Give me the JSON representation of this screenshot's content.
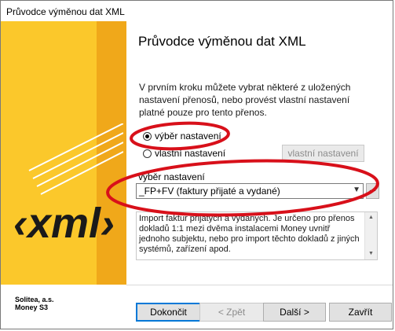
{
  "window": {
    "title": "Průvodce výměnou dat XML"
  },
  "wizard": {
    "heading": "Průvodce výměnou dat XML",
    "intro": "V prvním kroku můžete vybrat některé z uložených nastavení přenosů, nebo provést vlastní nastavení platné pouze pro tento přenos.",
    "options": [
      {
        "label": "výběr nastavení",
        "checked": true
      },
      {
        "label": "vlastní nastavení",
        "checked": false
      }
    ],
    "custom_settings_button": "vlastní nastavení",
    "select_label": "výběr nastavení",
    "select_value": "_FP+FV (faktury přijaté a vydané)",
    "description": "Import faktur přijatých a vydaných. Je určeno pro přenos dokladů 1:1 mezi dvěma instalacemi Money uvnitř jednoho subjektu, nebo pro import těchto dokladů z jiných systémů, zařízení apod."
  },
  "vendor": {
    "line1": "Solitea, a.s.",
    "line2": "Money S3"
  },
  "logo": {
    "text": "‹xml›"
  },
  "buttons": {
    "finish": "Dokončit",
    "back": "< Zpět",
    "next": "Další >",
    "close": "Zavřít"
  },
  "colors": {
    "panel": "#fbc82b",
    "panel_stripe": "#f0a81a",
    "annotation": "#d8101a",
    "default_button_border": "#0078d7"
  }
}
